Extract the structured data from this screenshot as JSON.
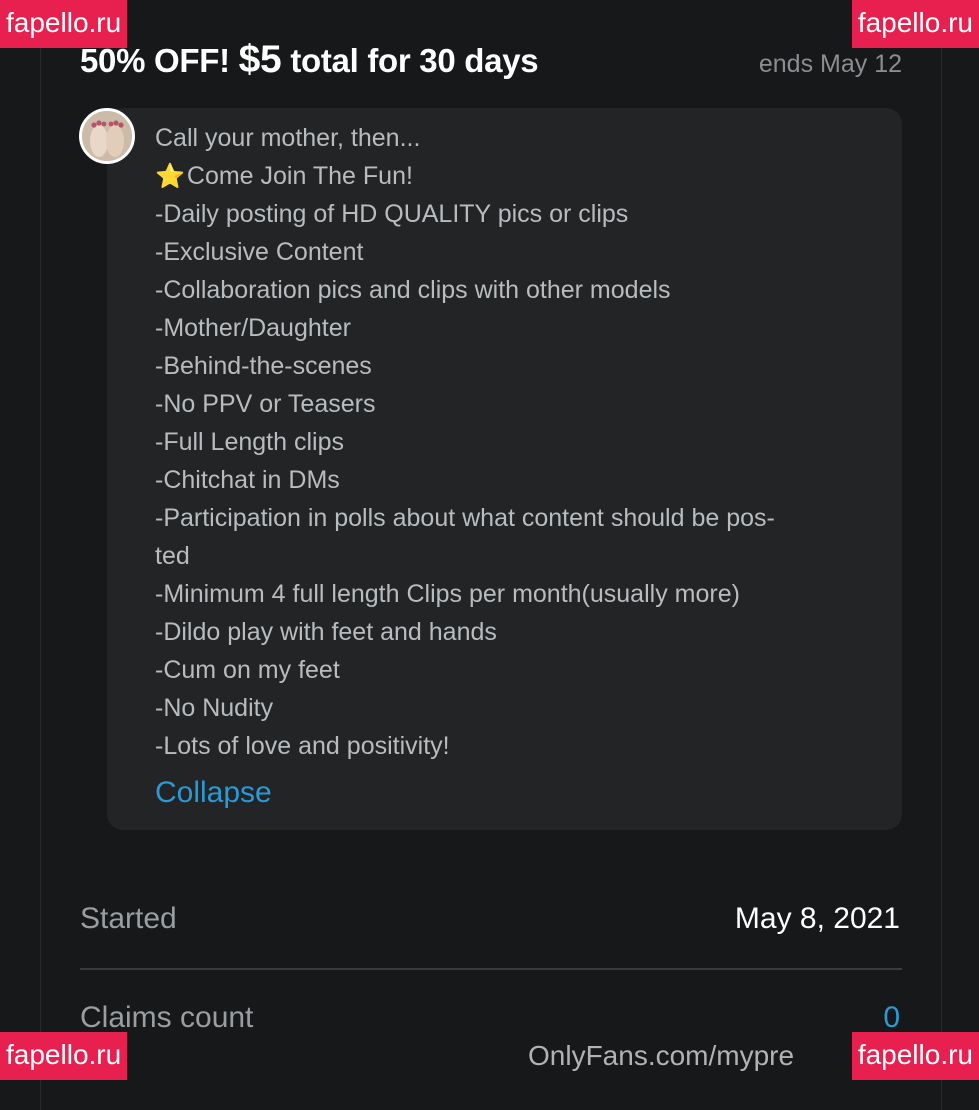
{
  "promo": {
    "title_prefix": "50% OFF! ",
    "price": "$5",
    "title_suffix": " total for 30 days",
    "ends": "ends May 12"
  },
  "description": {
    "lines": [
      "Call your mother, then...",
      "Come Join The Fun!",
      "-Daily posting of HD QUALITY pics or clips",
      "-Exclusive Content",
      "-Collaboration pics and clips with other models",
      "-Mother/Daughter",
      "-Behind-the-scenes",
      "-No PPV or Teasers",
      "-Full Length clips",
      "-Chitchat in DMs",
      "-Participation in polls about what content should be pos-",
      "ted",
      "-Minimum 4 full length Clips per month(usually more)",
      "-Dildo play with feet and hands",
      "-Cum on my feet",
      "-No Nudity",
      "-Lots of love and positivity!"
    ],
    "star_icon": "⭐",
    "collapse_label": "Collapse"
  },
  "details": {
    "started_label": "Started",
    "started_value": "May 8, 2021",
    "claims_label": "Claims count",
    "claims_value": "0"
  },
  "footer": {
    "url": "OnlyFans.com/mypre"
  },
  "watermark": {
    "text": "fapello.ru",
    "color": "#e8204f"
  }
}
